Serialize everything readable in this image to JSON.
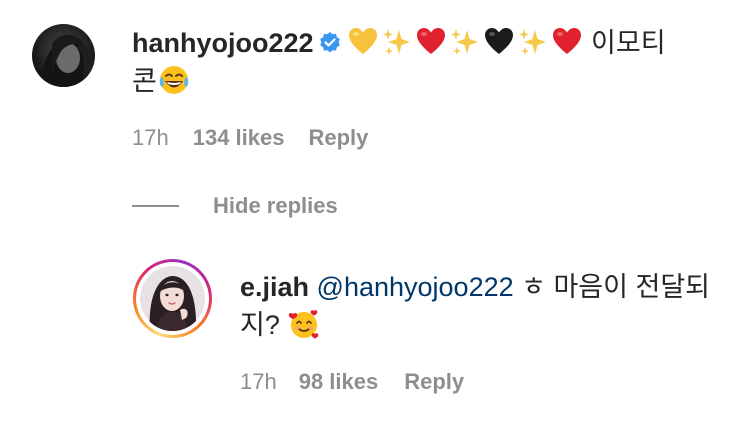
{
  "comment": {
    "username": "hanhyojoo222",
    "verified_icon": "verified-badge-icon",
    "emojis_line": [
      "yellow-heart",
      "sparkles",
      "red-heart",
      "sparkles",
      "black-heart",
      "sparkles",
      "red-heart"
    ],
    "text_part1": " 이모티",
    "text_part2": "콘",
    "trailing_emoji": "face-with-tears-of-joy",
    "time": "17h",
    "likes": "134 likes",
    "reply_label": "Reply"
  },
  "hide_replies": {
    "label": "Hide replies"
  },
  "reply": {
    "username": "e.jiah",
    "mention": "@hanhyojoo222",
    "text_part1": " ㅎ 마음이 전달되",
    "text_part2": "지? ",
    "trailing_emoji": "smiling-face-with-hearts",
    "time": "17h",
    "likes": "98 likes",
    "reply_label": "Reply"
  },
  "colors": {
    "text": "#262626",
    "secondary": "#8e8e8e",
    "mention": "#00376b",
    "verified": "#3897f0"
  }
}
